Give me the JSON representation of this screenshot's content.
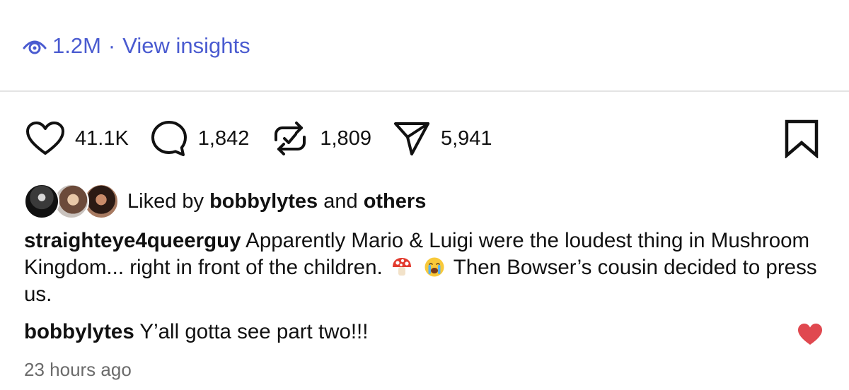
{
  "insights": {
    "icon": "eye-icon",
    "views": "1.2M",
    "separator": "·",
    "link_label": "View insights",
    "color": "#4a5bd0"
  },
  "actions": {
    "likes": "41.1K",
    "comments": "1,842",
    "reposts": "1,809",
    "shares": "5,941"
  },
  "liked_by": {
    "prefix": "Liked by",
    "user": "bobbylytes",
    "conjunction": "and",
    "others": "others"
  },
  "caption": {
    "username": "straighteye4queerguy",
    "text_part1": "Apparently Mario & Luigi were the loudest thing in Mushroom Kingdom... right in front of the children.",
    "emojis": [
      "mushroom-emoji",
      "crying-face-emoji"
    ],
    "text_part2": "Then Bowser’s cousin decided to press us."
  },
  "comment": {
    "username": "bobbylytes",
    "text": "Y’all gotta see part two!!!",
    "liked": true,
    "like_color": "#e0484f"
  },
  "timestamp": "23 hours ago"
}
